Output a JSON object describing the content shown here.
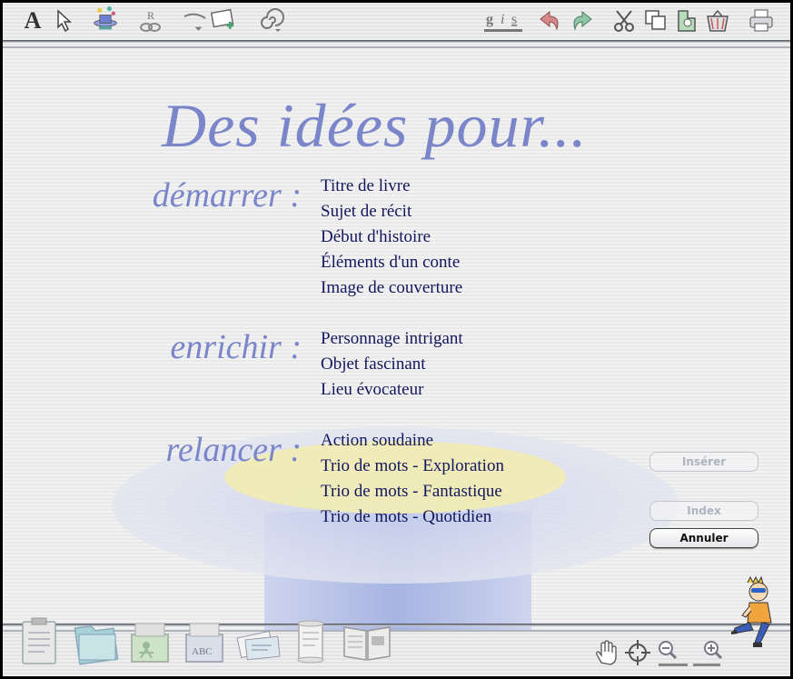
{
  "toolbar_top": {
    "icons": [
      "text-tool-icon",
      "arrow-pointer-icon",
      "magic-hat-icon",
      "recording-link-icon",
      "speech-bubble-add-icon",
      "spiral-icon",
      "gis-format-icon",
      "undo-icon",
      "redo-icon",
      "scissors-icon",
      "copy-icon",
      "paste-icon",
      "trash-icon",
      "printer-icon"
    ],
    "text_tool_label": "A",
    "format_label_g": "g",
    "format_label_i": "i",
    "format_label_s": "s",
    "recording_label": "R"
  },
  "main": {
    "title": "Des idées pour...",
    "sections": [
      {
        "label": "démarrer :",
        "items": [
          "Titre de livre",
          "Sujet de récit",
          "Début d'histoire",
          "Éléments d'un conte",
          "Image de couverture"
        ]
      },
      {
        "label": "enrichir :",
        "items": [
          "Personnage intrigant",
          "Objet fascinant",
          "Lieu évocateur"
        ]
      },
      {
        "label": "relancer :",
        "items": [
          "Action soudaine",
          "Trio de mots - Exploration",
          "Trio de mots - Fantastique",
          "Trio de mots - Quotidien"
        ]
      }
    ]
  },
  "buttons": {
    "insert": "Insérer",
    "index": "Index",
    "cancel": "Annuler"
  },
  "toolbar_bottom": {
    "icons": [
      "notepad-icon",
      "folder-icon",
      "character-box-icon",
      "abc-box-icon",
      "cards-icon",
      "scroll-icon",
      "open-book-icon",
      "hand-icon",
      "crosshair-icon",
      "zoom-out-icon",
      "zoom-in-icon"
    ],
    "abc_label": "ABC"
  },
  "colors": {
    "title": "#7a86c9",
    "items": "#12175e",
    "hat_blue": "#8fa0dc",
    "hat_yellow": "#f2ecb2"
  }
}
